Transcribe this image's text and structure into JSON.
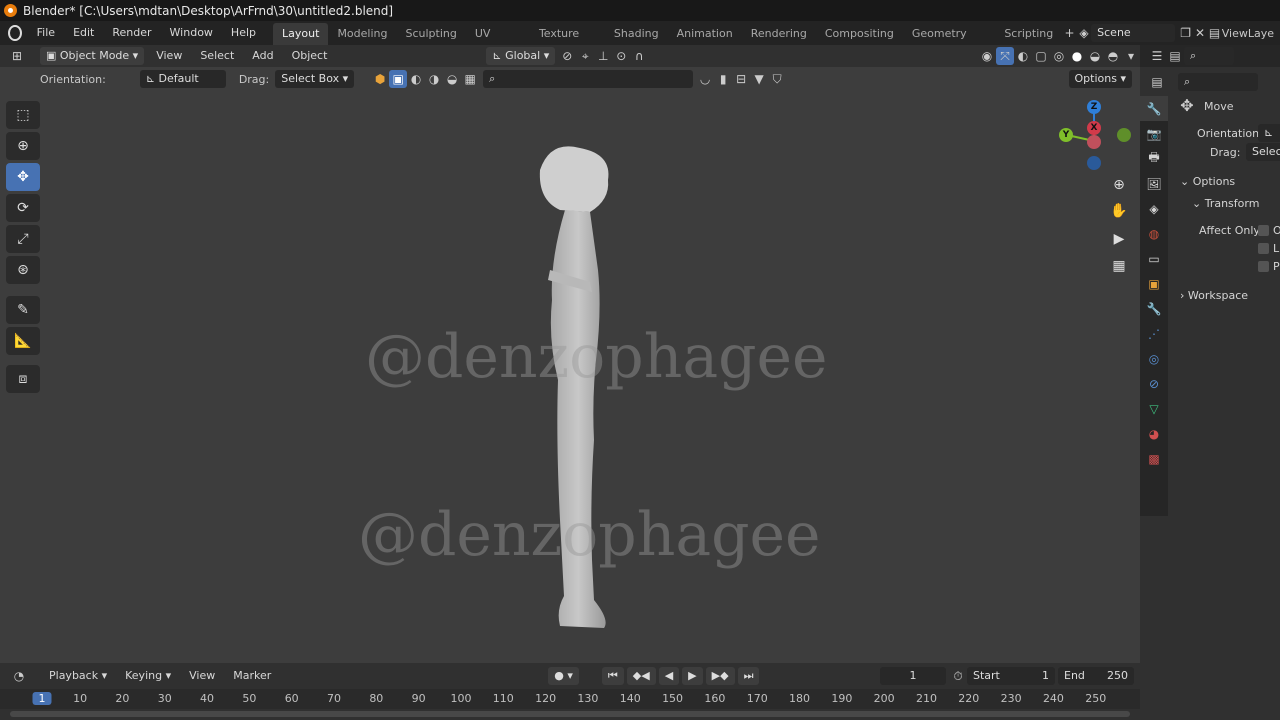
{
  "window": {
    "title": "Blender* [C:\\Users\\mdtan\\Desktop\\ArFrnd\\30\\untitled2.blend]"
  },
  "menu": [
    "File",
    "Edit",
    "Render",
    "Window",
    "Help"
  ],
  "workspaces": [
    "Layout",
    "Modeling",
    "Sculpting",
    "UV Editing",
    "Texture Paint",
    "Shading",
    "Animation",
    "Rendering",
    "Compositing",
    "Geometry Nodes",
    "Scripting"
  ],
  "scene": {
    "name": "Scene",
    "view_layer": "ViewLaye"
  },
  "viewport_header": {
    "mode": "Object Mode",
    "menus": [
      "View",
      "Select",
      "Add",
      "Object"
    ],
    "transform_orientation": "Global"
  },
  "tool_header": {
    "orientation_label": "Orientation:",
    "orientation_value": "Default",
    "drag_label": "Drag:",
    "drag_value": "Select Box",
    "options_label": "Options"
  },
  "watermark": "@denzophagee",
  "gizmo": {
    "z": "Z",
    "y": "Y",
    "x": "X"
  },
  "side_panel": {
    "tool_name": "Move",
    "orientation_label": "Orientation",
    "drag_label": "Drag:",
    "drag_value": "Select",
    "options_section": "Options",
    "transform_section": "Transform",
    "affect_only_label": "Affect Only",
    "affect_items": [
      "O",
      "L",
      "P"
    ],
    "workspace_section": "Workspace"
  },
  "timeline": {
    "menus": [
      "Playback",
      "Keying",
      "View",
      "Marker"
    ],
    "current_frame": "1",
    "start_label": "Start",
    "start_value": "1",
    "end_label": "End",
    "end_value": "250",
    "ruler": [
      "1",
      "10",
      "20",
      "30",
      "40",
      "50",
      "60",
      "70",
      "80",
      "90",
      "100",
      "110",
      "120",
      "130",
      "140",
      "150",
      "160",
      "170",
      "180",
      "190",
      "200",
      "210",
      "220",
      "230",
      "240",
      "250"
    ]
  },
  "colors": {
    "accent": "#4772b3",
    "x_axis": "#d13a4a",
    "y_axis": "#7fbf2a",
    "z_axis": "#2f7fd8"
  }
}
